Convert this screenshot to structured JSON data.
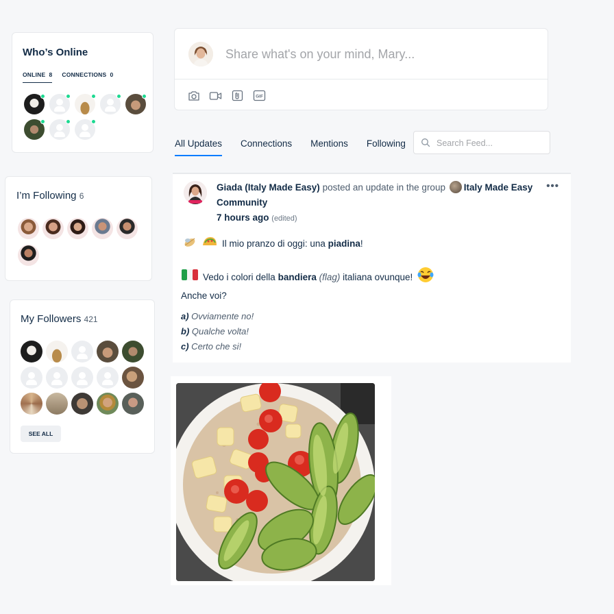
{
  "whos_online": {
    "title": "Who’s Online",
    "tab_online": "ONLINE",
    "tab_online_count": "8",
    "tab_connections": "CONNECTIONS",
    "tab_connections_count": "0",
    "avatars": [
      {
        "type": "photo",
        "online": true,
        "color": "#2b2b2b"
      },
      {
        "type": "blank",
        "online": true
      },
      {
        "type": "photo",
        "online": true,
        "color": "#c6a26a"
      },
      {
        "type": "blank",
        "online": true
      },
      {
        "type": "photo",
        "online": true,
        "color": "#6a5a46"
      },
      {
        "type": "photo",
        "online": true,
        "color": "#4a5d3c"
      },
      {
        "type": "blank",
        "online": true
      },
      {
        "type": "blank",
        "online": true
      }
    ]
  },
  "following": {
    "title": "I’m Following",
    "count": "6"
  },
  "followers": {
    "title": "My Followers",
    "count": "421",
    "see_all": "SEE ALL"
  },
  "composer": {
    "placeholder": "Share what's on your mind, Mary...",
    "tools": [
      "camera-icon",
      "video-icon",
      "attachment-icon",
      "gif-icon"
    ],
    "gif_label": "GIF"
  },
  "feed_tabs": {
    "all_updates": "All Updates",
    "connections": "Connections",
    "mentions": "Mentions",
    "following": "Following",
    "search_placeholder": "Search Feed..."
  },
  "post": {
    "author": "Giada (Italy Made Easy)",
    "action": " posted an update in the group ",
    "group": "Italy Made Easy Community",
    "time": "7 hours ago",
    "edited": "(edited)",
    "line1_text": "Il mio pranzo di oggi: una ",
    "line1_bold": "piadina",
    "line1_end": "!",
    "line2_a": "Vedo i colori della ",
    "line2_bold": "bandiera",
    "line2_ital": "(flag)",
    "line2_b": " italiana ovunque!",
    "line3": "Anche voi?",
    "opt_a_key": "a)",
    "opt_a": " Ovviamente no!",
    "opt_b_key": "b)",
    "opt_b": " Qualche volta!",
    "opt_c_key": "c)",
    "opt_c": " Certo che si!"
  },
  "colors": {
    "accent": "#007cff",
    "online": "#1cd991",
    "text": "#122b46",
    "muted": "#a3a5a9"
  }
}
